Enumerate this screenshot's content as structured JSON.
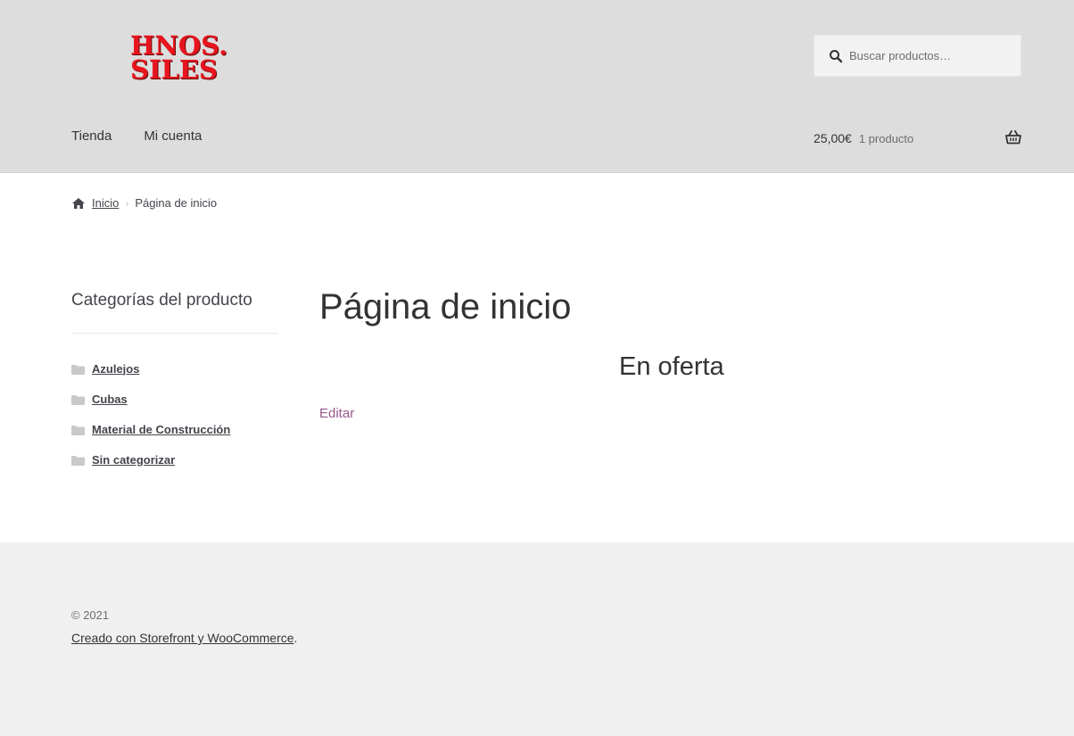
{
  "header": {
    "logo_line1": "HNOS.",
    "logo_line2": "SILES",
    "logo_color": "#e8141e",
    "background": "#dddddd"
  },
  "search": {
    "placeholder": "Buscar productos…",
    "value": ""
  },
  "nav": {
    "items": [
      {
        "label": "Tienda"
      },
      {
        "label": "Mi cuenta"
      }
    ]
  },
  "cart": {
    "amount": "25,00€",
    "count": "1 producto",
    "icon": "basket-icon"
  },
  "breadcrumb": {
    "home_label": "Inicio",
    "current": "Página de inicio"
  },
  "sidebar": {
    "title": "Categorías del producto",
    "categories": [
      {
        "label": "Azulejos"
      },
      {
        "label": "Cubas"
      },
      {
        "label": "Material de Construcción"
      },
      {
        "label": "Sin categorizar"
      }
    ]
  },
  "main": {
    "page_title": "Página de inicio",
    "section_title": "En oferta",
    "edit_label": "Editar",
    "edit_color": "#96588a"
  },
  "footer": {
    "copyright": "© 2021",
    "credit_link": "Creado con Storefront y WooCommerce",
    "credit_suffix": "."
  }
}
